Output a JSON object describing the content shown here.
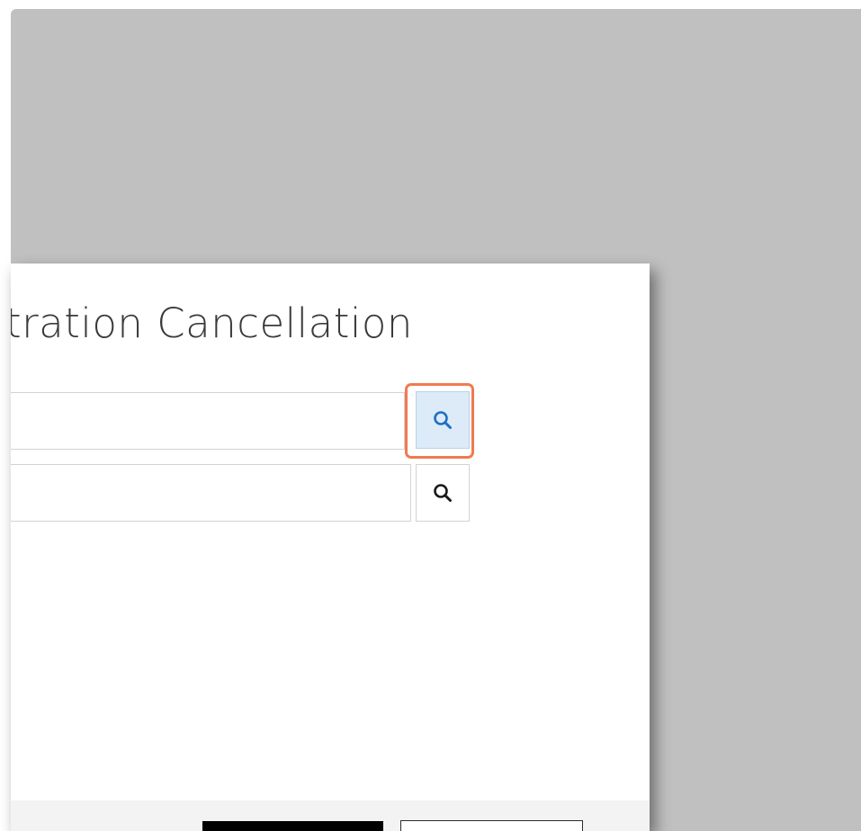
{
  "dialog": {
    "title": "tration Cancellation",
    "fields": [
      {
        "value": "",
        "lookup_icon": "search-icon",
        "lookup_color": "#1f6fc5",
        "state": "hovered"
      },
      {
        "value": "",
        "lookup_icon": "search-icon",
        "lookup_color": "#1a1a1a",
        "state": "default"
      }
    ],
    "footer": {
      "primary_label": "",
      "secondary_label": ""
    }
  },
  "colors": {
    "overlay": "#c0c0c0",
    "highlight": "#f07a50",
    "hover_bg": "#dcebf7"
  }
}
